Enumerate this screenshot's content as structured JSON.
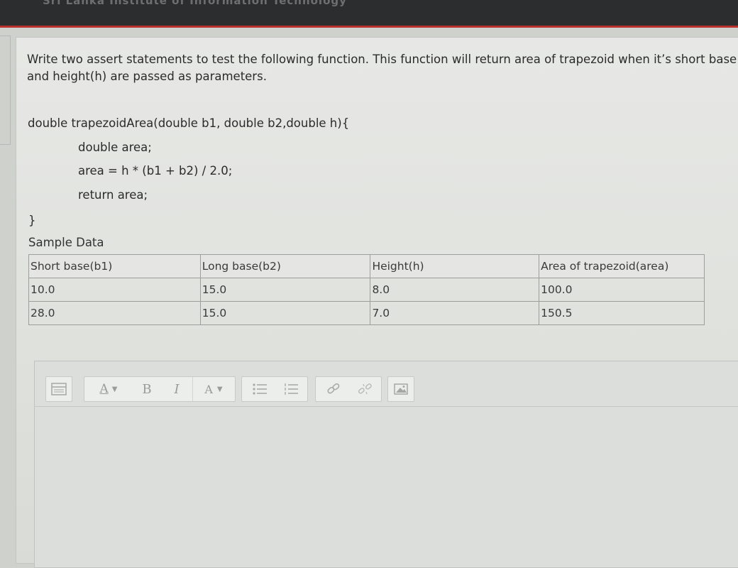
{
  "header": {
    "site_title": "Sri Lanka Institute of Information Technology"
  },
  "question": {
    "line1": "Write two assert statements to test the following function. This function will return area of trapezoid when it’s short base",
    "line2": "and height(h) are passed as parameters."
  },
  "code": {
    "signature": "double trapezoidArea(double b1, double b2,double h){",
    "line1": "double area;",
    "line2": "area = h * (b1 + b2) / 2.0;",
    "line3": "return area;",
    "closing": "}"
  },
  "sample": {
    "label": "Sample Data",
    "headers": [
      "Short base(b1)",
      "Long base(b2)",
      "Height(h)",
      "Area of trapezoid(area)"
    ],
    "rows": [
      [
        "10.0",
        "15.0",
        "8.0",
        "100.0"
      ],
      [
        "28.0",
        "15.0",
        "7.0",
        "150.5"
      ]
    ]
  },
  "toolbar": {
    "font_size_label": "A",
    "bold_label": "B",
    "italic_label": "I",
    "text_color_label": "A"
  }
}
